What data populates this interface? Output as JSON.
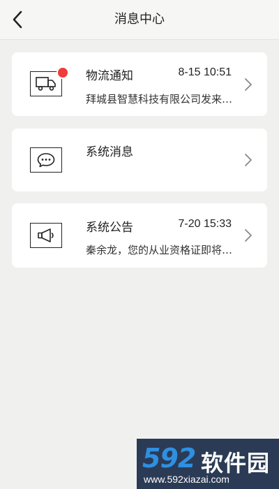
{
  "header": {
    "title": "消息中心",
    "back_icon": "chevron-left-icon"
  },
  "messages": [
    {
      "category": "物流通知",
      "time": "8-15 10:51",
      "preview": "拜城县智慧科技有限公司发来一条物流信息",
      "icon": "truck-icon",
      "unread": true
    },
    {
      "category": "系统消息",
      "time": "",
      "preview": "",
      "icon": "chat-bubble-icon",
      "unread": false
    },
    {
      "category": "系统公告",
      "time": "7-20 15:33",
      "preview": "秦余龙，您的从业资格证即将到期",
      "icon": "megaphone-icon",
      "unread": false
    }
  ],
  "watermark": {
    "logo_number": "592",
    "logo_text": "软件园",
    "url": "www.592xiazai.com"
  },
  "colors": {
    "background": "#f0f1ef",
    "card": "#ffffff",
    "unread_dot": "#ee3b3b",
    "watermark_bg": "#2b3b55",
    "watermark_accent": "#2f8fe0"
  }
}
